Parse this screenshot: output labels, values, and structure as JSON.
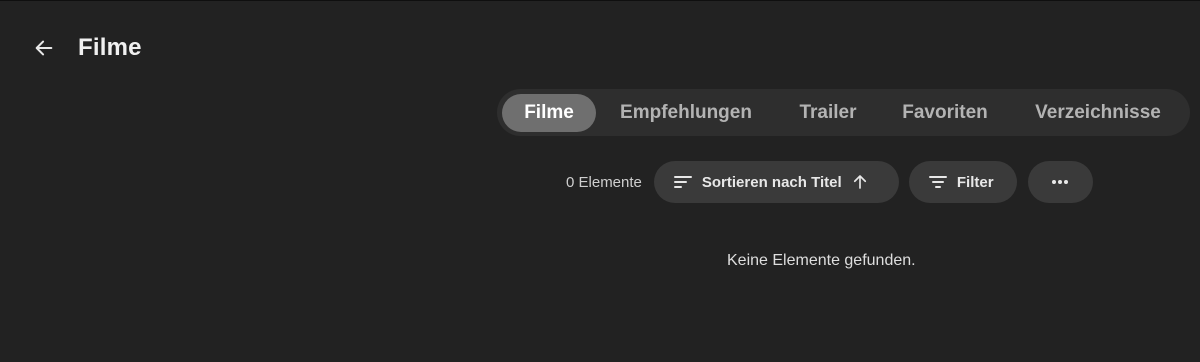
{
  "header": {
    "title": "Filme",
    "back_icon": "arrow-left-icon"
  },
  "tabs": [
    {
      "label": "Filme",
      "active": true
    },
    {
      "label": "Empfehlungen",
      "active": false
    },
    {
      "label": "Trailer",
      "active": false
    },
    {
      "label": "Favoriten",
      "active": false
    },
    {
      "label": "Verzeichnisse",
      "active": false
    }
  ],
  "toolbar": {
    "count": "0 Elemente",
    "sort_label": "Sortieren nach Titel",
    "sort_icon": "sort-lines-icon",
    "sort_direction_icon": "arrow-up-icon",
    "filter_label": "Filter",
    "filter_icon": "filter-icon",
    "more_icon": "more-horizontal-icon"
  },
  "empty_message": "Keine Elemente gefunden.",
  "colors": {
    "background": "#222222",
    "tabbar": "#2e2e2e",
    "active_tab": "#6f6f6f",
    "pill": "#3a3a3a"
  }
}
